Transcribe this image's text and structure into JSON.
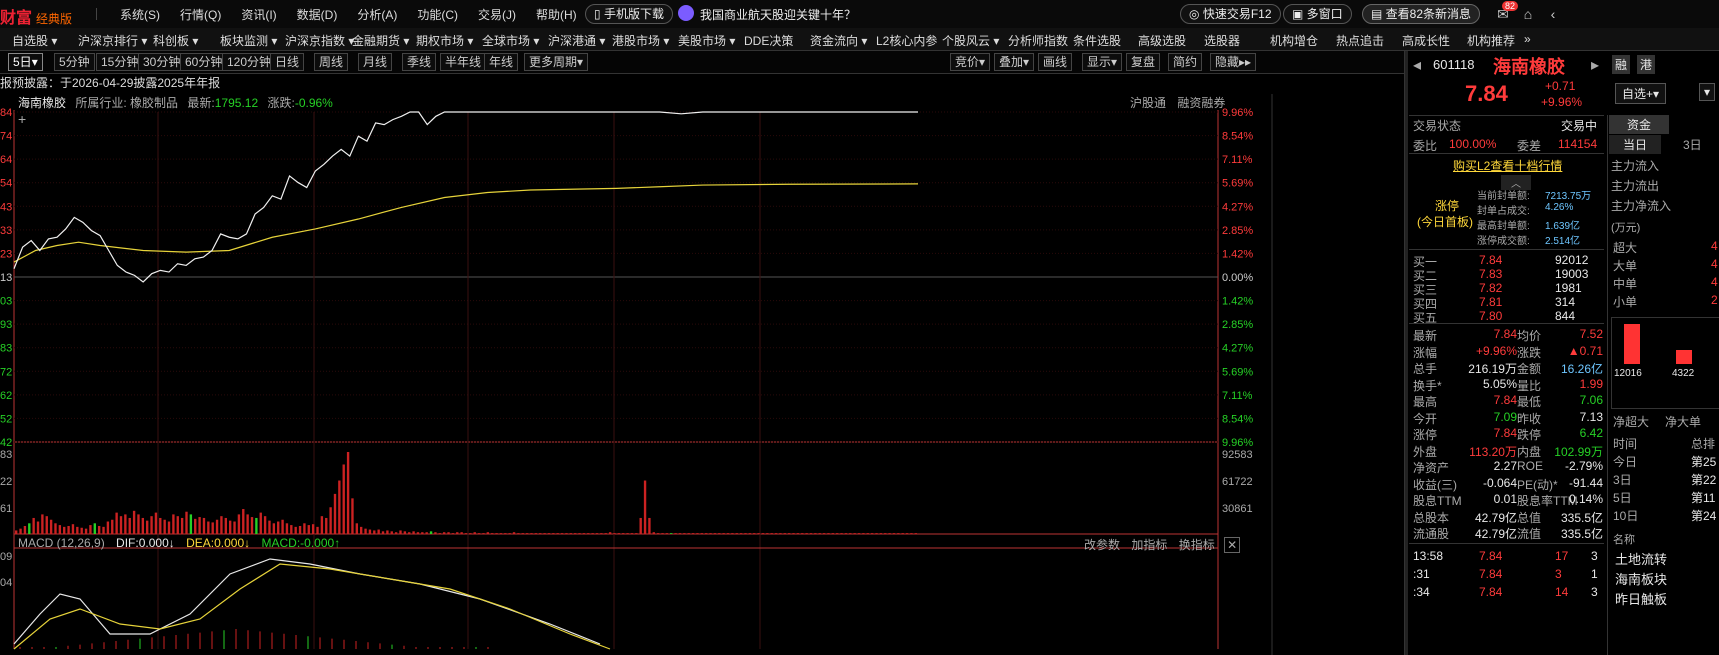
{
  "app": {
    "logo": "财富",
    "edition": "经典版",
    "menu": [
      "系统(S)",
      "行情(Q)",
      "资讯(I)",
      "数据(D)",
      "分析(A)",
      "功能(C)",
      "交易(J)",
      "帮助(H)"
    ],
    "mobile_download": "手机版下载",
    "headline": "我国商业航天股迎关键十年？",
    "quick_trade": "快速交易F12",
    "multi_window": "多窗口",
    "news_button": "查看82条新消息",
    "mail_badge": "82"
  },
  "navbar": [
    "自选股",
    "沪深京排行",
    "科创板",
    "板块监测",
    "沪深京指数",
    "金融期货",
    "期权市场",
    "全球市场",
    "沪深港通",
    "港股市场",
    "美股市场",
    "DDE决策",
    "资金流向",
    "L2核心内参",
    "个股风云",
    "分析师指数",
    "条件选股",
    "高级选股",
    "选股器",
    "机构增仓",
    "热点追击",
    "高成长性",
    "机构推荐"
  ],
  "periods": [
    "5日",
    "5分钟",
    "15分钟",
    "30分钟",
    "60分钟",
    "120分钟",
    "日线",
    "周线",
    "月线",
    "季线",
    "半年线",
    "年线",
    "更多周期"
  ],
  "tools": [
    "竞价",
    "叠加",
    "画线",
    "显示",
    "复盘",
    "简约",
    "隐藏"
  ],
  "notice": "报预披露：于2026-04-29披露2025年年报",
  "stock_header": {
    "name": "海南橡胶",
    "industry_label": "所属行业:",
    "industry": "橡胶制品",
    "latest_label": "最新:",
    "latest": "1795.12",
    "change_label": "涨跌:",
    "change": "-0.96%",
    "links": [
      "沪股通",
      "融资融券"
    ]
  },
  "chart_data": {
    "type": "line",
    "y_pct_ticks": [
      "9.96%",
      "8.54%",
      "7.11%",
      "5.69%",
      "4.27%",
      "2.85%",
      "1.42%",
      "0.00%",
      "1.42%",
      "2.85%",
      "4.27%",
      "5.69%",
      "7.11%",
      "8.54%",
      "9.96%"
    ],
    "y_price_ticks": [
      "84",
      "74",
      "64",
      "54",
      "43",
      "33",
      "23",
      "13",
      "03",
      "93",
      "83",
      "72",
      "62",
      "52",
      "42"
    ],
    "pct_range": [
      -9.96,
      9.96
    ],
    "price_series": [
      [
        0,
        0.5
      ],
      [
        2,
        1.8
      ],
      [
        4,
        2.2
      ],
      [
        6,
        1.6
      ],
      [
        8,
        2.3
      ],
      [
        10,
        2.4
      ],
      [
        12,
        2.9
      ],
      [
        14,
        3.6
      ],
      [
        16,
        3.3
      ],
      [
        18,
        2.8
      ],
      [
        20,
        2.5
      ],
      [
        22,
        1.6
      ],
      [
        24,
        0.7
      ],
      [
        26,
        0.3
      ],
      [
        28,
        0.1
      ],
      [
        30,
        -0.3
      ],
      [
        32,
        0.2
      ],
      [
        34,
        0.4
      ],
      [
        36,
        0.3
      ],
      [
        38,
        0.8
      ],
      [
        40,
        0.7
      ],
      [
        42,
        1.1
      ],
      [
        44,
        1.2
      ],
      [
        46,
        1.6
      ],
      [
        48,
        2.6
      ],
      [
        50,
        2.4
      ],
      [
        52,
        2.3
      ],
      [
        54,
        2.6
      ],
      [
        56,
        3.8
      ],
      [
        58,
        4.2
      ],
      [
        60,
        4.9
      ],
      [
        62,
        4.7
      ],
      [
        64,
        6.1
      ],
      [
        66,
        5.7
      ],
      [
        68,
        5.4
      ],
      [
        70,
        6.4
      ],
      [
        72,
        6.8
      ],
      [
        74,
        7.3
      ],
      [
        76,
        7.7
      ],
      [
        78,
        7.3
      ],
      [
        80,
        8.5
      ],
      [
        82,
        8.2
      ],
      [
        84,
        9.3
      ],
      [
        86,
        9.2
      ],
      [
        88,
        9.5
      ],
      [
        90,
        9.7
      ],
      [
        92,
        9.96
      ],
      [
        94,
        9.96
      ],
      [
        96,
        9.2
      ],
      [
        98,
        9.7
      ],
      [
        100,
        9.96
      ],
      [
        110,
        9.96
      ],
      [
        120,
        9.96
      ],
      [
        140,
        9.96
      ],
      [
        150,
        9.96
      ],
      [
        155,
        9.85
      ],
      [
        160,
        9.96
      ],
      [
        180,
        9.96
      ],
      [
        200,
        9.96
      ],
      [
        210,
        9.96
      ]
    ],
    "avg_series": [
      [
        0,
        0.9
      ],
      [
        5,
        1.6
      ],
      [
        10,
        1.9
      ],
      [
        15,
        2.1
      ],
      [
        20,
        1.9
      ],
      [
        30,
        1.6
      ],
      [
        40,
        1.5
      ],
      [
        50,
        1.6
      ],
      [
        60,
        2.4
      ],
      [
        70,
        2.9
      ],
      [
        80,
        3.5
      ],
      [
        90,
        4.2
      ],
      [
        100,
        4.8
      ],
      [
        110,
        5.1
      ],
      [
        120,
        5.25
      ],
      [
        140,
        5.35
      ],
      [
        150,
        5.45
      ],
      [
        160,
        5.55
      ],
      [
        180,
        5.6
      ],
      [
        210,
        5.62
      ]
    ],
    "volume_ticks": [
      "92583",
      "61722",
      "30861"
    ],
    "volume_labels_left": [
      "83",
      "22",
      "61"
    ],
    "volume": [
      4,
      6,
      9,
      12,
      18,
      14,
      22,
      20,
      16,
      12,
      10,
      8,
      9,
      11,
      8,
      7,
      6,
      10,
      12,
      9,
      8,
      14,
      16,
      24,
      20,
      22,
      18,
      26,
      22,
      18,
      15,
      20,
      24,
      18,
      16,
      14,
      22,
      20,
      18,
      25,
      22,
      17,
      19,
      18,
      14,
      13,
      16,
      20,
      18,
      15,
      14,
      22,
      28,
      22,
      19,
      18,
      24,
      20,
      15,
      12,
      14,
      16,
      12,
      10,
      8,
      9,
      12,
      10,
      11,
      8,
      20,
      18,
      30,
      45,
      60,
      78,
      92,
      40,
      12,
      8,
      6,
      5,
      4,
      5,
      3,
      4,
      3,
      2,
      4,
      3,
      2,
      3,
      2,
      2,
      2,
      3,
      2,
      1,
      2,
      2,
      1,
      2,
      2,
      1,
      1,
      2,
      1,
      1,
      2,
      1,
      1,
      1,
      1,
      1,
      2,
      1,
      1,
      1,
      1,
      1,
      1,
      1,
      1,
      1,
      1,
      1,
      1,
      1,
      1,
      1,
      1,
      1,
      1,
      1,
      1,
      1,
      2,
      1,
      1,
      1,
      1,
      1,
      1,
      18,
      60,
      18,
      2,
      1,
      1,
      1,
      1,
      1,
      1,
      1,
      1,
      1,
      1,
      1,
      1,
      1,
      1,
      1,
      1,
      1,
      1,
      1,
      1,
      1,
      1,
      1,
      1,
      1,
      1,
      1,
      1,
      1,
      1,
      1,
      1,
      1,
      1,
      1,
      1,
      1,
      1,
      1,
      1,
      1,
      1,
      1,
      1,
      1,
      1,
      1,
      1,
      1,
      1,
      1,
      1,
      1,
      1,
      1,
      1,
      1,
      1,
      1,
      1
    ],
    "green_volume_idx": [
      3,
      18,
      40,
      55,
      95,
      150
    ],
    "macd": {
      "title": "MACD (12,26,9)",
      "dif_label": "DIF:",
      "dif": "0.000",
      "dea_label": "DEA:",
      "dea": "0.000",
      "macd_label": "MACD:",
      "macd": "-0.000",
      "tools": [
        "改参数",
        "加指标",
        "换指标"
      ],
      "left_labels": [
        "09",
        "04"
      ]
    }
  },
  "quote": {
    "code": "601118",
    "name": "海南橡胶",
    "tags": [
      "融",
      "港"
    ],
    "price": "7.84",
    "change": "+0.71",
    "pct": "+9.96%",
    "watch_button": "自选+",
    "status_label": "交易状态",
    "status": "交易中",
    "webi_label": "委比",
    "webi": "100.00%",
    "weicha_label": "委差",
    "weicha": "114154",
    "l2_link": "购买L2查看十档行情",
    "limit_up": "涨停",
    "limit_up_sub": "(今日首板)",
    "seal": [
      {
        "label": "当前封单额:",
        "value": "7213.75万"
      },
      {
        "label": "封单占成交:",
        "value": "4.26%"
      },
      {
        "label": "最高封单额:",
        "value": "1.639亿"
      },
      {
        "label": "涨停成交额:",
        "value": "2.514亿"
      }
    ],
    "bids": [
      {
        "label": "买一",
        "price": "7.84",
        "vol": "92012"
      },
      {
        "label": "买二",
        "price": "7.83",
        "vol": "19003"
      },
      {
        "label": "买三",
        "price": "7.82",
        "vol": "1981"
      },
      {
        "label": "买四",
        "price": "7.81",
        "vol": "314"
      },
      {
        "label": "买五",
        "price": "7.80",
        "vol": "844"
      }
    ],
    "stats": [
      {
        "l1": "最新",
        "v1": "7.84",
        "c1": "red",
        "l2": "均价",
        "v2": "7.52",
        "c2": "red"
      },
      {
        "l1": "涨幅",
        "v1": "+9.96%",
        "c1": "red",
        "l2": "涨跌",
        "v2": "▲0.71",
        "c2": "red"
      },
      {
        "l1": "总手",
        "v1": "216.19万",
        "c1": "white",
        "l2": "金额",
        "v2": "16.26亿",
        "c2": "cyan"
      },
      {
        "l1": "换手*",
        "v1": "5.05%",
        "c1": "white",
        "l2": "量比",
        "v2": "1.99",
        "c2": "red"
      },
      {
        "l1": "最高",
        "v1": "7.84",
        "c1": "red",
        "l2": "最低",
        "v2": "7.06",
        "c2": "green"
      },
      {
        "l1": "今开",
        "v1": "7.09",
        "c1": "green",
        "l2": "昨收",
        "v2": "7.13",
        "c2": "white"
      },
      {
        "l1": "涨停",
        "v1": "7.84",
        "c1": "red",
        "l2": "跌停",
        "v2": "6.42",
        "c2": "green"
      },
      {
        "l1": "外盘",
        "v1": "113.20万",
        "c1": "red",
        "l2": "内盘",
        "v2": "102.99万",
        "c2": "green"
      },
      {
        "l1": "净资产",
        "v1": "2.27",
        "c1": "white",
        "l2": "ROE",
        "v2": "-2.79%",
        "c2": "white"
      },
      {
        "l1": "收益(三)",
        "v1": "-0.064",
        "c1": "white",
        "l2": "PE(动)*",
        "v2": "-91.44",
        "c2": "white"
      },
      {
        "l1": "股息TTM",
        "v1": "0.01",
        "c1": "white",
        "l2": "股息率TTM",
        "v2": "0.14%",
        "c2": "white"
      },
      {
        "l1": "总股本",
        "v1": "42.79亿",
        "c1": "white",
        "l2": "总值",
        "v2": "335.5亿",
        "c2": "white"
      },
      {
        "l1": "流通股",
        "v1": "42.79亿",
        "c1": "white",
        "l2": "流值",
        "v2": "335.5亿",
        "c2": "white"
      }
    ],
    "ticks": [
      {
        "time": "13:58",
        "price": "7.84",
        "vol": "17",
        "n": "3"
      },
      {
        "time": ":31",
        "price": "7.84",
        "vol": "3",
        "n": "1"
      },
      {
        "time": ":34",
        "price": "7.84",
        "vol": "14",
        "n": "3"
      }
    ]
  },
  "fund": {
    "tab": "资金",
    "periods": [
      "当日",
      "3日"
    ],
    "rows": [
      "主力流入",
      "主力流出",
      "主力净流入"
    ],
    "unit": "(万元)",
    "sizes": [
      {
        "label": "超大",
        "val": "4"
      },
      {
        "label": "大单",
        "val": "4"
      },
      {
        "label": "中单",
        "val": "4"
      },
      {
        "label": "小单",
        "val": "2"
      }
    ],
    "bar_values": [
      "12016",
      "4322"
    ],
    "bar_heights": [
      1.0,
      0.36
    ],
    "net_labels": [
      "净超大",
      "净大单"
    ],
    "time_header": [
      "时间",
      "总排"
    ],
    "time_rows": [
      {
        "t": "今日",
        "v": "第25"
      },
      {
        "t": "3日",
        "v": "第22"
      },
      {
        "t": "5日",
        "v": "第11"
      },
      {
        "t": "10日",
        "v": "第24"
      }
    ],
    "name_label": "名称",
    "concepts": [
      "土地流转",
      "海南板块",
      "昨日触板"
    ]
  }
}
